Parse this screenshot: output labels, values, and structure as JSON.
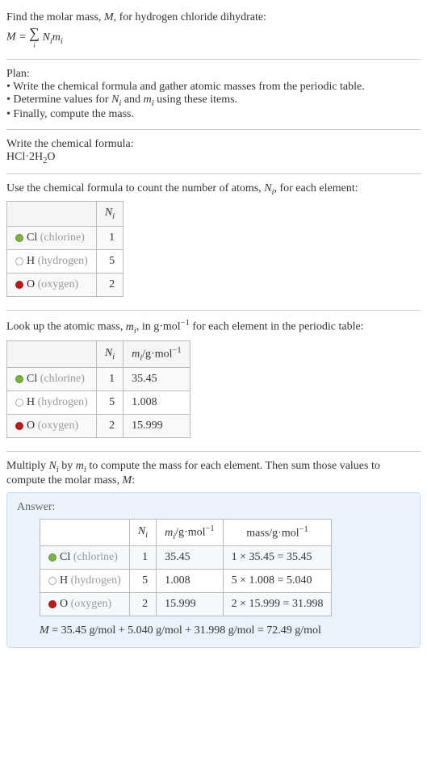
{
  "intro": {
    "line1": "Find the molar mass, ",
    "line1_var": "M",
    "line1_after": ", for hydrogen chloride dihydrate:",
    "formula_left": "M",
    "formula_eq": " = ",
    "formula_sigma_sub": "i",
    "formula_right_Ni": "N",
    "formula_right_Ni_sub": "i",
    "formula_right_mi": "m",
    "formula_right_mi_sub": "i"
  },
  "plan": {
    "heading": "Plan:",
    "b1": "• Write the chemical formula and gather atomic masses from the periodic table.",
    "b2_pre": "• Determine values for ",
    "b2_Ni": "N",
    "b2_Ni_sub": "i",
    "b2_and": " and ",
    "b2_mi": "m",
    "b2_mi_sub": "i",
    "b2_post": " using these items.",
    "b3": "• Finally, compute the mass."
  },
  "chem": {
    "heading": "Write the chemical formula:",
    "formula_a": "HCl·2H",
    "formula_sub": "2",
    "formula_b": "O"
  },
  "count": {
    "heading_pre": "Use the chemical formula to count the number of atoms, ",
    "heading_Ni": "N",
    "heading_Ni_sub": "i",
    "heading_post": ", for each element:",
    "header_Ni": "N",
    "header_Ni_sub": "i",
    "rows": [
      {
        "sym": "Cl",
        "name": "(chlorine)",
        "dot": "dot-cl",
        "n": "1"
      },
      {
        "sym": "H",
        "name": "(hydrogen)",
        "dot": "dot-h",
        "n": "5"
      },
      {
        "sym": "O",
        "name": "(oxygen)",
        "dot": "dot-o",
        "n": "2"
      }
    ]
  },
  "mass": {
    "heading_pre": "Look up the atomic mass, ",
    "heading_mi": "m",
    "heading_mi_sub": "i",
    "heading_mid": ", in g·mol",
    "heading_sup": "−1",
    "heading_post": " for each element in the periodic table:",
    "header_Ni": "N",
    "header_Ni_sub": "i",
    "header_mi": "m",
    "header_mi_sub": "i",
    "header_unit": "/g·mol",
    "header_sup": "−1",
    "rows": [
      {
        "sym": "Cl",
        "name": "(chlorine)",
        "dot": "dot-cl",
        "n": "1",
        "m": "35.45"
      },
      {
        "sym": "H",
        "name": "(hydrogen)",
        "dot": "dot-h",
        "n": "5",
        "m": "1.008"
      },
      {
        "sym": "O",
        "name": "(oxygen)",
        "dot": "dot-o",
        "n": "2",
        "m": "15.999"
      }
    ]
  },
  "multiply": {
    "pre": "Multiply ",
    "Ni": "N",
    "Ni_sub": "i",
    "by": " by ",
    "mi": "m",
    "mi_sub": "i",
    "mid": " to compute the mass for each element. Then sum those values to compute the molar mass, ",
    "M": "M",
    "post": ":"
  },
  "answer": {
    "label": "Answer:",
    "header_Ni": "N",
    "header_Ni_sub": "i",
    "header_mi": "m",
    "header_mi_sub": "i",
    "header_unit": "/g·mol",
    "header_sup": "−1",
    "header_mass": "mass/g·mol",
    "header_mass_sup": "−1",
    "rows": [
      {
        "sym": "Cl",
        "name": "(chlorine)",
        "dot": "dot-cl",
        "n": "1",
        "m": "35.45",
        "calc": "1 × 35.45 = 35.45"
      },
      {
        "sym": "H",
        "name": "(hydrogen)",
        "dot": "dot-h",
        "n": "5",
        "m": "1.008",
        "calc": "5 × 1.008 = 5.040"
      },
      {
        "sym": "O",
        "name": "(oxygen)",
        "dot": "dot-o",
        "n": "2",
        "m": "15.999",
        "calc": "2 × 15.999 = 31.998"
      }
    ],
    "final_M": "M",
    "final_eq": " = 35.45 g/mol + 5.040 g/mol + 31.998 g/mol = 72.49 g/mol"
  }
}
